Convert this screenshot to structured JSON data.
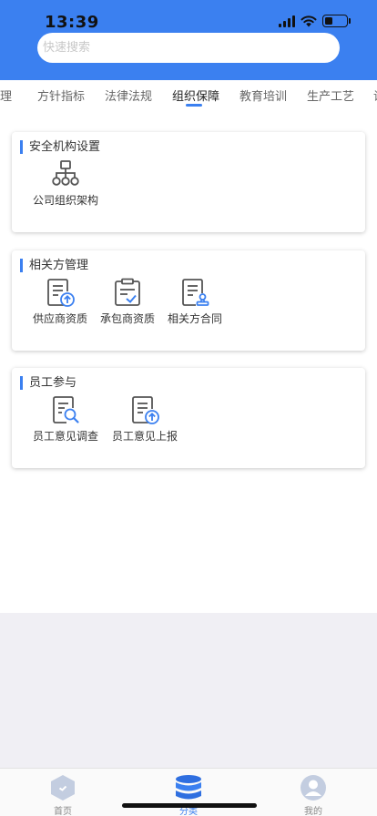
{
  "status": {
    "time": "13:39"
  },
  "search": {
    "placeholder": "快速搜索"
  },
  "tabs": [
    {
      "label": "管理"
    },
    {
      "label": "方针指标"
    },
    {
      "label": "法律法规"
    },
    {
      "label": "组织保障"
    },
    {
      "label": "教育培训"
    },
    {
      "label": "生产工艺"
    },
    {
      "label": "设"
    }
  ],
  "cards": [
    {
      "title": "安全机构设置",
      "items": [
        {
          "label": "公司组织架构",
          "icon": "org-chart-icon"
        }
      ]
    },
    {
      "title": "相关方管理",
      "items": [
        {
          "label": "供应商资质",
          "icon": "document-upload-icon"
        },
        {
          "label": "承包商资质",
          "icon": "clipboard-check-icon"
        },
        {
          "label": "相关方合同",
          "icon": "contract-stamp-icon"
        }
      ]
    },
    {
      "title": "员工参与",
      "items": [
        {
          "label": "员工意见调查",
          "icon": "document-search-icon"
        },
        {
          "label": "员工意见上报",
          "icon": "document-upload-icon"
        }
      ]
    }
  ],
  "tabbar": [
    {
      "label": "首页",
      "icon": "home-hexagon-icon"
    },
    {
      "label": "分类",
      "icon": "database-stack-icon"
    },
    {
      "label": "我的",
      "icon": "user-avatar-icon"
    }
  ],
  "colors": {
    "brand": "#3b80f0",
    "icon_gray": "#555555",
    "background_gray": "#f0eff4"
  }
}
